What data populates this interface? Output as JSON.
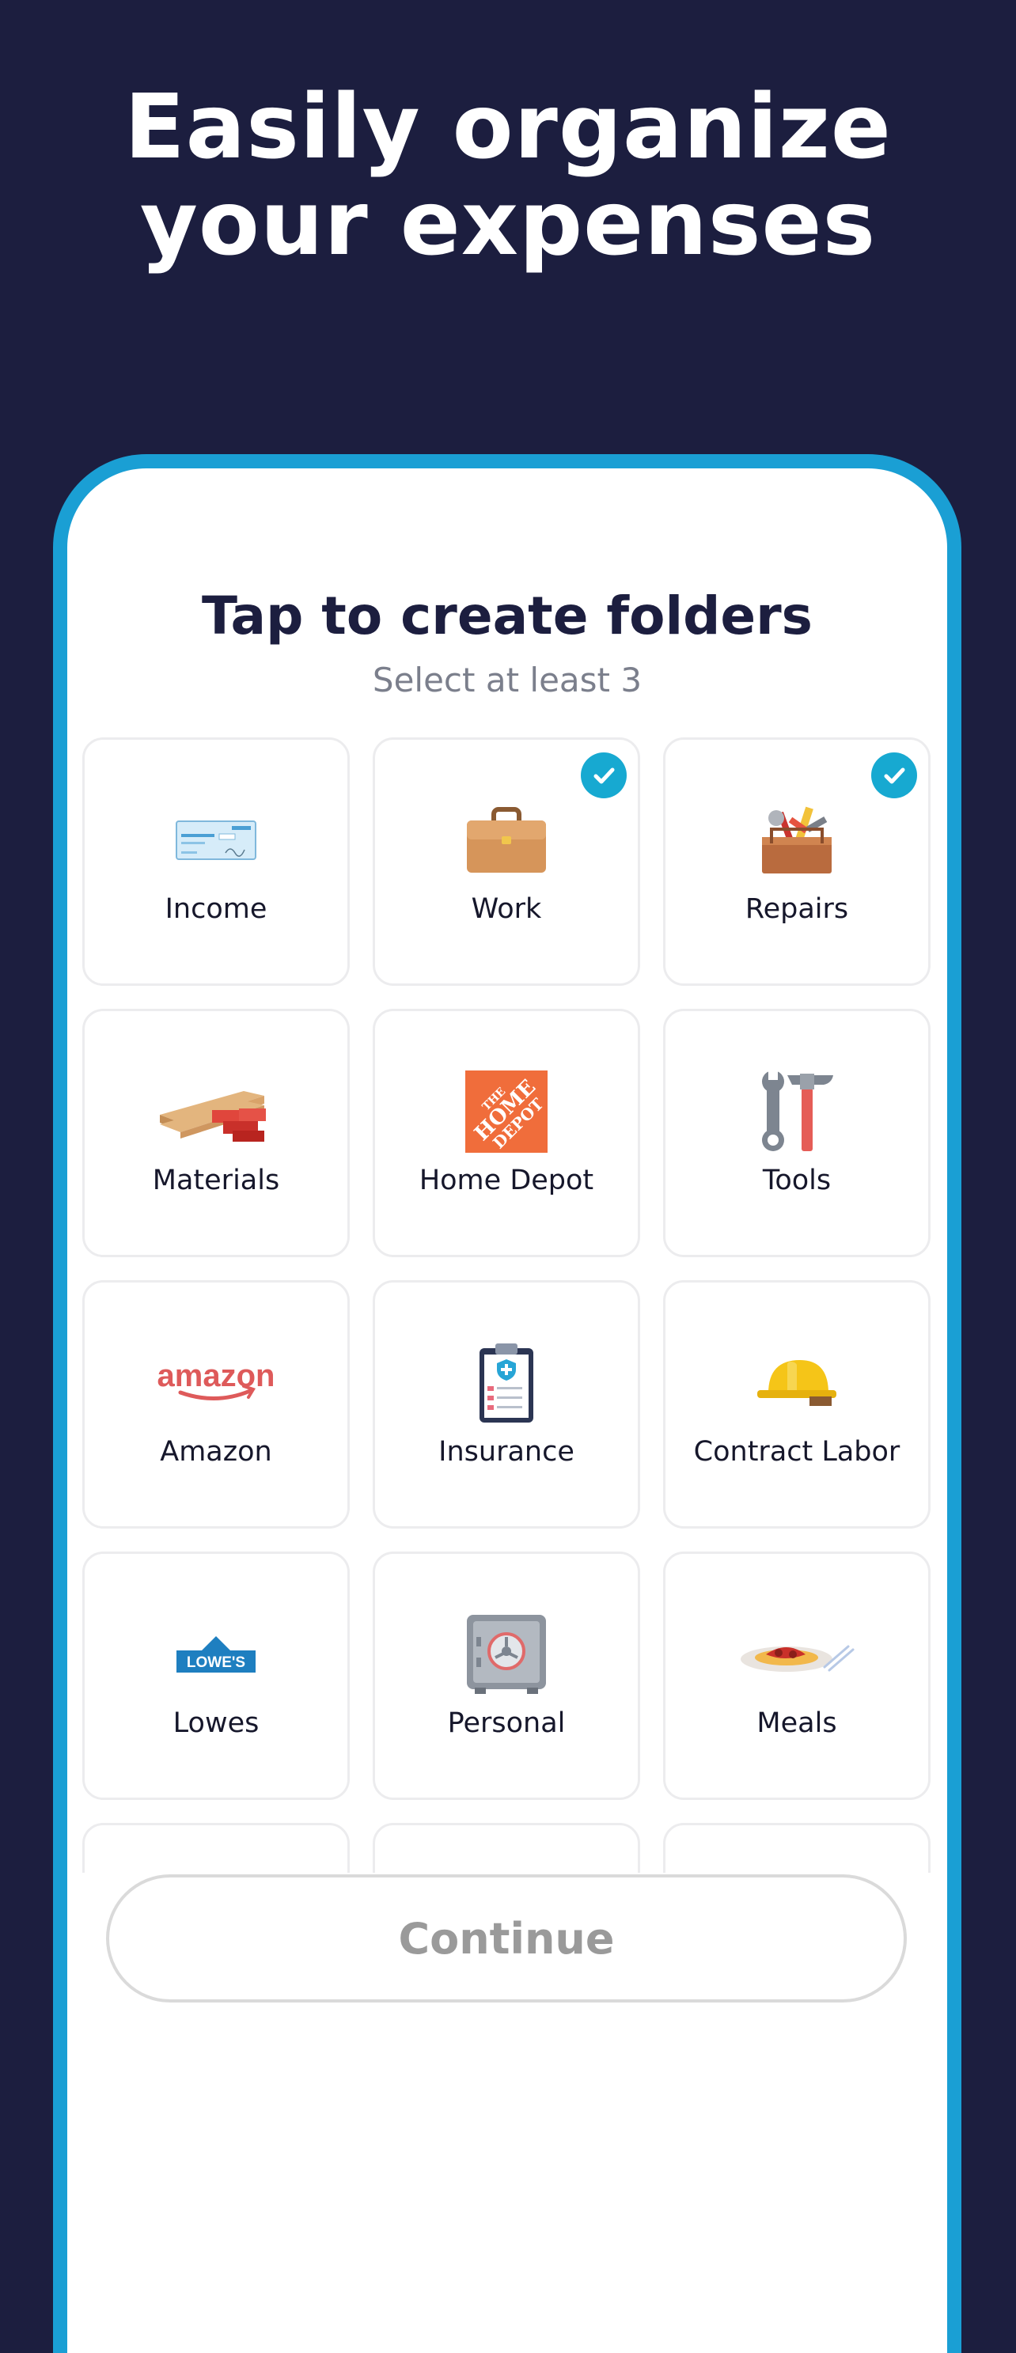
{
  "headline": {
    "line1": "Easily organize",
    "line2": "your expenses"
  },
  "screen": {
    "title": "Tap to create folders",
    "subtitle": "Select at least 3",
    "continue_label": "Continue"
  },
  "folders": [
    {
      "label": "Income",
      "icon": "check-paper-icon",
      "selected": false
    },
    {
      "label": "Work",
      "icon": "briefcase-icon",
      "selected": true
    },
    {
      "label": "Repairs",
      "icon": "toolbox-icon",
      "selected": true
    },
    {
      "label": "Materials",
      "icon": "lumber-bricks-icon",
      "selected": false
    },
    {
      "label": "Home Depot",
      "icon": "home-depot-logo",
      "selected": false
    },
    {
      "label": "Tools",
      "icon": "wrench-hammer-icon",
      "selected": false
    },
    {
      "label": "Amazon",
      "icon": "amazon-logo",
      "selected": false
    },
    {
      "label": "Insurance",
      "icon": "clipboard-shield-icon",
      "selected": false
    },
    {
      "label": "Contract Labor",
      "icon": "hard-hat-icon",
      "selected": false
    },
    {
      "label": "Lowes",
      "icon": "lowes-logo",
      "selected": false
    },
    {
      "label": "Personal",
      "icon": "safe-icon",
      "selected": false
    },
    {
      "label": "Meals",
      "icon": "spaghetti-plate-icon",
      "selected": false
    }
  ],
  "logos": {
    "home_depot": [
      "THE",
      "HOME",
      "DEPOT"
    ],
    "amazon": "amazon",
    "lowes": "LOWE'S"
  },
  "colors": {
    "background": "#1c1e3f",
    "phone_frame": "#1a9fd4",
    "check_badge": "#17a9d1",
    "title_text": "#1c1e3f"
  }
}
